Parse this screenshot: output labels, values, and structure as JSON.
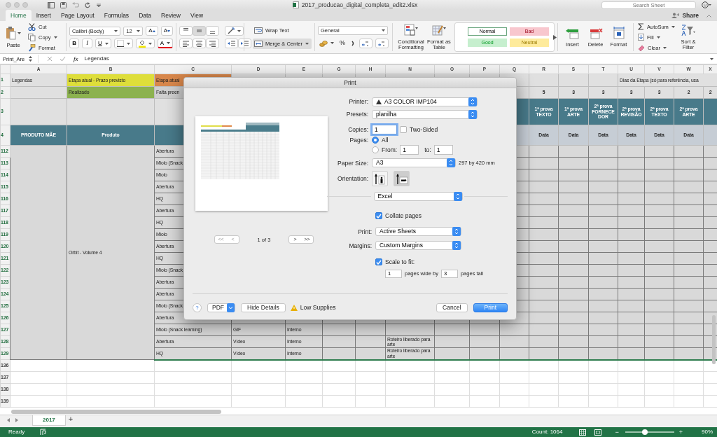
{
  "window": {
    "title": "2017_producao_digital_completa_edit2.xlsx"
  },
  "search": {
    "placeholder": "Search Sheet"
  },
  "ribbon_tabs": [
    {
      "label": "Home",
      "selected": true
    },
    {
      "label": "Insert",
      "selected": false
    },
    {
      "label": "Page Layout",
      "selected": false
    },
    {
      "label": "Formulas",
      "selected": false
    },
    {
      "label": "Data",
      "selected": false
    },
    {
      "label": "Review",
      "selected": false
    },
    {
      "label": "View",
      "selected": false
    }
  ],
  "share": "Share",
  "ribbon": {
    "paste": "Paste",
    "cut": "Cut",
    "copy": "Copy",
    "format_painter": "Format",
    "font_name": "Calibri (Body)",
    "font_size": "12",
    "grow_font": "A",
    "shrink_font": "A",
    "bold": "B",
    "italic": "I",
    "underline": "U",
    "font_color": "A",
    "wrap_text": "Wrap Text",
    "merge_center": "Merge & Center",
    "number_format": "General",
    "percent": "%",
    "conditional_formatting": "Conditional Formatting",
    "format_as_table": "Format as Table",
    "styles": [
      {
        "label": "Normal",
        "color": "#ffffff",
        "selected": true
      },
      {
        "label": "Bad",
        "color": "#f8c7ce",
        "selected": false
      },
      {
        "label": "Good",
        "color": "#c6efce",
        "selected": false
      },
      {
        "label": "Neutral",
        "color": "#feeb9c",
        "selected": false
      }
    ],
    "cells": [
      {
        "kind": "insert",
        "label": "Insert"
      },
      {
        "kind": "delete",
        "label": "Delete"
      },
      {
        "kind": "format",
        "label": "Format"
      }
    ],
    "autosum": "AutoSum",
    "fill": "Fill",
    "clear": "Clear",
    "sort_filter": "Sort & Filter"
  },
  "formula_bar": {
    "name_box": "Print_Are",
    "fx": "fx",
    "formula": "Legendas"
  },
  "sheet": {
    "columns": [
      "A",
      "B",
      "C",
      "D",
      "E",
      "G",
      "H",
      "N",
      "O",
      "P",
      "Q",
      "R",
      "S",
      "T",
      "U",
      "V",
      "W",
      "X"
    ],
    "header_rows": [
      {
        "number": "1",
        "kind": "legend",
        "cells": {
          "A": {
            "text": "Legendas"
          },
          "B": {
            "text": "Etapa atual - Prazo previsto",
            "color": "#dede3a"
          },
          "C": {
            "text": "Etapa atual",
            "color": "#d8874b"
          }
        },
        "note": "Dias da Etapa (só para referência, usa"
      },
      {
        "number": "2",
        "kind": "legend",
        "cells": {
          "B": {
            "text": "Realizado",
            "color": "#8cb24f"
          },
          "C": {
            "text": "Falta preen",
            "color": "#cfcfcf"
          },
          "R": {
            "text": "5"
          },
          "S": {
            "text": "3"
          },
          "T": {
            "text": "3"
          },
          "U": {
            "text": "3"
          },
          "V": {
            "text": "3"
          },
          "W": {
            "text": "2"
          },
          "X": {
            "text": "2"
          }
        }
      },
      {
        "number": "3",
        "kind": "tall",
        "cells": {
          "Q": {
            "color": "#487a8a"
          },
          "R": {
            "text": "1ª prova TEXTO",
            "color": "#487a8a"
          },
          "S": {
            "text": "1ª prova ARTE",
            "color": "#487a8a"
          },
          "T": {
            "text": "2ª prova FORNECEDOR",
            "color": "#487a8a"
          },
          "U": {
            "text": "2ª prova REVISÃO",
            "color": "#487a8a"
          },
          "V": {
            "text": "2ª prova TEXTO",
            "color": "#487a8a"
          },
          "W": {
            "text": "2ª prova ARTE",
            "color": "#487a8a"
          },
          "X": {
            "color": "#487a8a"
          }
        }
      },
      {
        "number": "4",
        "kind": "header",
        "cells": {
          "A": {
            "text": "PRODUTO MÃE",
            "color": "#487a8a"
          },
          "B": {
            "text": "Produto",
            "color": "#487a8a"
          },
          "C": {
            "color": "#487a8a"
          },
          "Q": {
            "color": "#c6cdd5"
          },
          "R": {
            "text": "Data",
            "color": "#c6cdd5"
          },
          "S": {
            "text": "Data",
            "color": "#c6cdd5"
          },
          "T": {
            "text": "Data",
            "color": "#c6cdd5"
          },
          "U": {
            "text": "Data",
            "color": "#c6cdd5"
          },
          "V": {
            "text": "Data",
            "color": "#c6cdd5"
          },
          "W": {
            "text": "Data",
            "color": "#c6cdd5"
          },
          "X": {
            "color": "#c6cdd5"
          }
        }
      }
    ],
    "block": {
      "product": "Orbit - Volume 4",
      "rows": [
        {
          "number": "112",
          "cells": {
            "C": {
              "text": "Abertura"
            }
          }
        },
        {
          "number": "113",
          "cells": {
            "C": {
              "text": "Miolo (Snack"
            }
          }
        },
        {
          "number": "114",
          "cells": {
            "C": {
              "text": "Miolo"
            }
          }
        },
        {
          "number": "115",
          "cells": {
            "C": {
              "text": "Abertura"
            }
          }
        },
        {
          "number": "116",
          "cells": {
            "C": {
              "text": "HQ"
            }
          }
        },
        {
          "number": "117",
          "cells": {
            "C": {
              "text": "Abertura"
            }
          }
        },
        {
          "number": "118",
          "cells": {
            "C": {
              "text": "HQ"
            }
          }
        },
        {
          "number": "119",
          "cells": {
            "C": {
              "text": "Miolo"
            }
          }
        },
        {
          "number": "120",
          "cells": {
            "C": {
              "text": "Abertura"
            }
          }
        },
        {
          "number": "121",
          "cells": {
            "C": {
              "text": "HQ"
            }
          }
        },
        {
          "number": "122",
          "cells": {
            "C": {
              "text": "Miolo (Snack"
            }
          }
        },
        {
          "number": "123",
          "cells": {
            "C": {
              "text": "Abertura"
            }
          }
        },
        {
          "number": "124",
          "cells": {
            "C": {
              "text": "Abertura"
            }
          }
        },
        {
          "number": "125",
          "cells": {
            "C": {
              "text": "Miolo (Snack"
            }
          }
        },
        {
          "number": "126",
          "cells": {
            "C": {
              "text": "Abertura"
            }
          }
        },
        {
          "number": "127",
          "cells": {
            "C": {
              "text": "Miolo (Snack learning)"
            },
            "D": {
              "text": "GIF"
            },
            "E": {
              "text": "Interno"
            }
          }
        },
        {
          "number": "128",
          "cells": {
            "C": {
              "text": "Abertura"
            },
            "D": {
              "text": "Vídeo"
            },
            "E": {
              "text": "Interno"
            },
            "N": {
              "text": "Roteiro liberado para arte"
            }
          }
        },
        {
          "number": "129",
          "cells": {
            "C": {
              "text": "HQ"
            },
            "D": {
              "text": "Vídeo"
            },
            "E": {
              "text": "Interno"
            },
            "N": {
              "text": "Roteiro liberado para arte"
            }
          }
        }
      ]
    },
    "empty_rows": [
      "136",
      "137",
      "138",
      "139"
    ]
  },
  "print_dialog": {
    "title": "Print",
    "page_label": "1 of 3",
    "nav": [
      "<<",
      "<",
      ">",
      ">>"
    ],
    "printer": {
      "label": "Printer:",
      "value": "A3 COLOR IMP104"
    },
    "presets": {
      "label": "Presets:",
      "value": "planilha"
    },
    "copies": {
      "label": "Copies:",
      "value": "1"
    },
    "two_sided": {
      "label": "Two-Sided",
      "checked": false
    },
    "pages": {
      "label": "Pages:",
      "options": [
        {
          "label": "All",
          "selected": true
        },
        {
          "label": "From:",
          "selected": false
        }
      ],
      "from": "1",
      "to_label": "to:",
      "to": "1"
    },
    "paper_size": {
      "label": "Paper Size:",
      "value": "A3",
      "dimensions": "297 by 420 mm"
    },
    "orientation": {
      "label": "Orientation:",
      "options": [
        {
          "kind": "portrait",
          "selected": false
        },
        {
          "kind": "landscape",
          "selected": true
        }
      ]
    },
    "section": "Excel",
    "collate": {
      "label": "Collate pages",
      "checked": true
    },
    "print_what": {
      "label": "Print:",
      "value": "Active Sheets"
    },
    "margins": {
      "label": "Margins:",
      "value": "Custom Margins"
    },
    "scale": {
      "label": "Scale to fit:",
      "checked": true,
      "wide": "1",
      "wide_label": "pages wide by",
      "tall": "3",
      "tall_label": "pages tall"
    },
    "help": "?",
    "pdf": "PDF",
    "hide_details": "Hide Details",
    "low_supplies": "Low Supplies",
    "cancel": "Cancel",
    "print": "Print"
  },
  "sheet_tabs": [
    {
      "label": "2017",
      "selected": true
    }
  ],
  "add_sheet": "+",
  "status_bar": {
    "status": "Ready",
    "count": "Count: 1064",
    "zoom_out": "−",
    "zoom_in": "+",
    "zoom": {
      "level": 0.4
    },
    "zoom_label": "90%"
  }
}
